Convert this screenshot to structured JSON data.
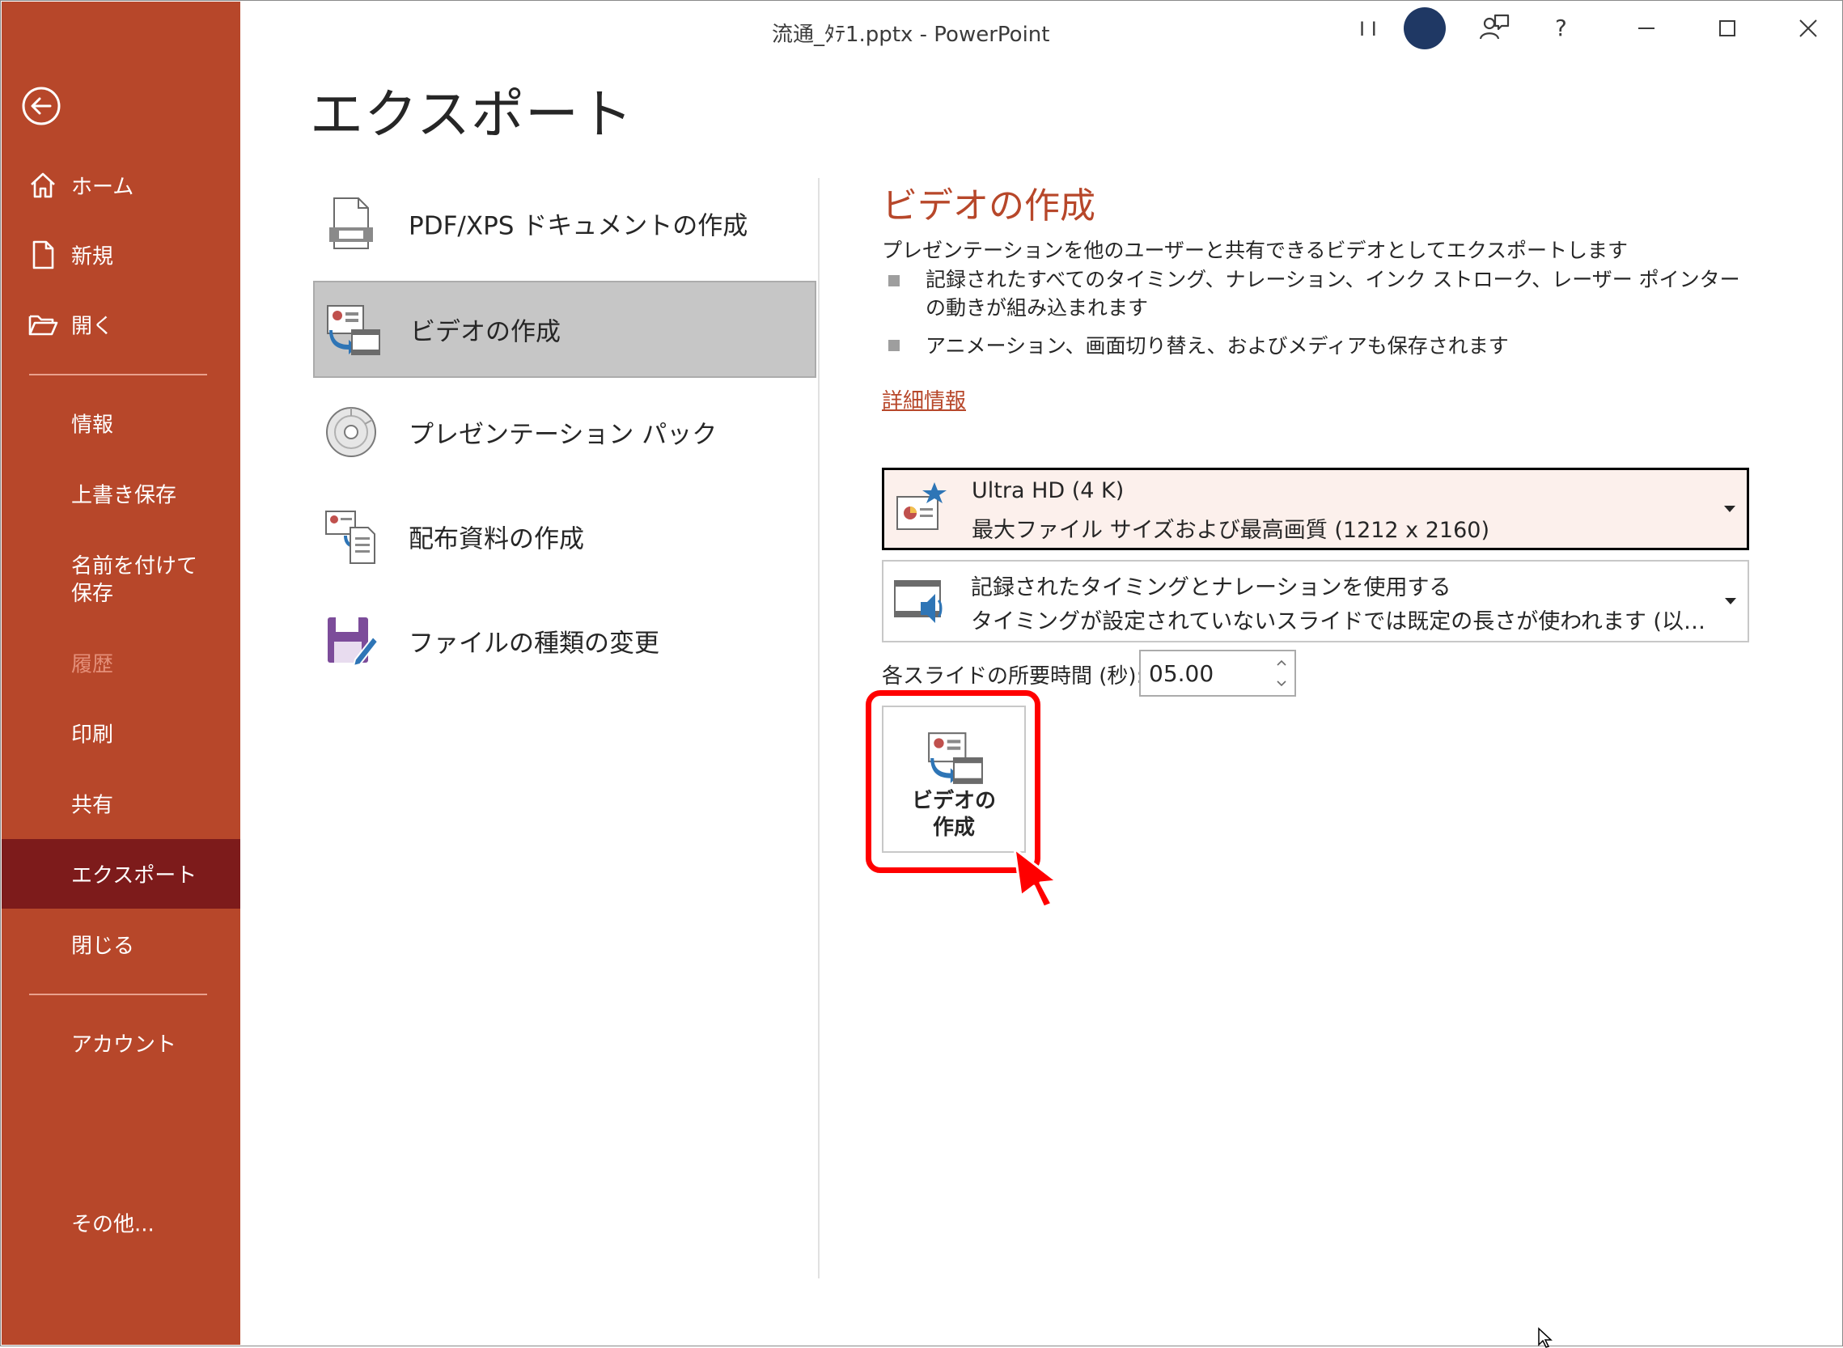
{
  "window": {
    "title": "流通_ﾀﾃ1.pptx  -  PowerPoint",
    "user_initials": "I I",
    "help": "?",
    "avatar_color": "#1f3864"
  },
  "colors": {
    "sidebar_bg": "#b7472a",
    "sidebar_selected_bg": "#7d1b1b",
    "accent": "#b7472a",
    "highlight_red": "#ff0000"
  },
  "sidebar": {
    "back_icon": "back-arrow-icon",
    "items": [
      {
        "label": "ホーム",
        "icon": "home-icon"
      },
      {
        "label": "新規",
        "icon": "new-document-icon"
      },
      {
        "label": "開く",
        "icon": "open-folder-icon"
      },
      {
        "label": "情報"
      },
      {
        "label": "上書き保存"
      },
      {
        "label": "名前を付けて保存"
      },
      {
        "label": "履歴",
        "state": "disabled"
      },
      {
        "label": "印刷"
      },
      {
        "label": "共有"
      },
      {
        "label": "エクスポート",
        "state": "selected"
      },
      {
        "label": "閉じる"
      },
      {
        "label": "アカウント"
      },
      {
        "label": "その他..."
      }
    ]
  },
  "main": {
    "title": "エクスポート",
    "options": [
      {
        "label": "PDF/XPS ドキュメントの作成",
        "icon": "pdf-document-icon"
      },
      {
        "label": "ビデオの作成",
        "icon": "video-create-icon",
        "selected": true
      },
      {
        "label": "プレゼンテーション パック",
        "icon": "cd-package-icon"
      },
      {
        "label": "配布資料の作成",
        "icon": "handouts-icon"
      },
      {
        "label": "ファイルの種類の変更",
        "icon": "save-as-type-icon"
      }
    ]
  },
  "detail": {
    "title": "ビデオの作成",
    "description": "プレゼンテーションを他のユーザーと共有できるビデオとしてエクスポートします",
    "bullets": [
      "記録されたすべてのタイミング、ナレーション、インク ストローク、レーザー ポインターの動きが組み込まれます",
      "アニメーション、画面切り替え、およびメディアも保存されます"
    ],
    "more_info": "詳細情報",
    "quality": {
      "title": "Ultra HD (4 K)",
      "subtitle": "最大ファイル サイズおよび最高画質 (1212 x 2160)",
      "icon": "quality-star-icon"
    },
    "timing": {
      "title": "記録されたタイミングとナレーションを使用する",
      "subtitle": "タイミングが設定されていないスライドでは既定の長さが使われます (以下をご覧ください)。",
      "icon": "narration-speaker-icon"
    },
    "duration_label": "各スライドの所要時間 (秒):",
    "duration_value": "05.00",
    "create_button": {
      "line1": "ビデオの",
      "line2": "作成",
      "icon": "video-create-icon"
    }
  }
}
